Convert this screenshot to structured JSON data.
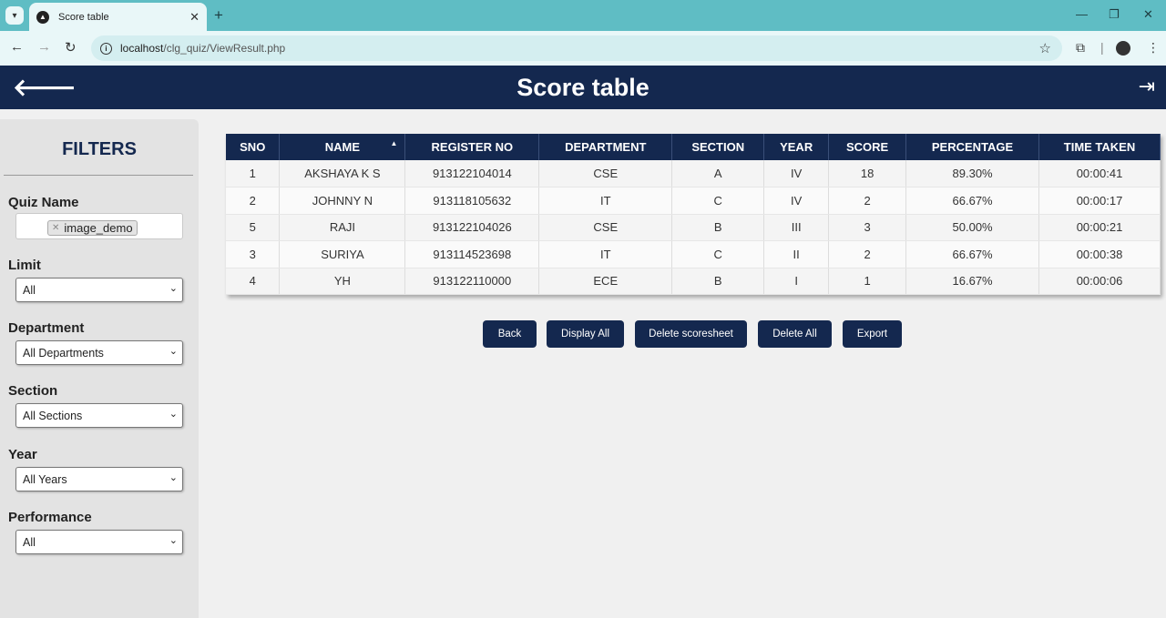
{
  "browser": {
    "tab_title": "Score table",
    "url_host": "localhost",
    "url_path": "/clg_quiz/ViewResult.php"
  },
  "header": {
    "title": "Score table"
  },
  "filters": {
    "heading": "FILTERS",
    "quiz_name_label": "Quiz Name",
    "quiz_chip": "image_demo",
    "limit_label": "Limit",
    "limit_value": "All",
    "department_label": "Department",
    "department_value": "All Departments",
    "section_label": "Section",
    "section_value": "All Sections",
    "year_label": "Year",
    "year_value": "All Years",
    "performance_label": "Performance",
    "performance_value": "All"
  },
  "table": {
    "headers": [
      "SNO",
      "NAME",
      "REGISTER NO",
      "DEPARTMENT",
      "SECTION",
      "YEAR",
      "SCORE",
      "PERCENTAGE",
      "TIME TAKEN"
    ],
    "rows": [
      [
        "1",
        "AKSHAYA K S",
        "913122104014",
        "CSE",
        "A",
        "IV",
        "18",
        "89.30%",
        "00:00:41"
      ],
      [
        "2",
        "JOHNNY N",
        "913118105632",
        "IT",
        "C",
        "IV",
        "2",
        "66.67%",
        "00:00:17"
      ],
      [
        "5",
        "RAJI",
        "913122104026",
        "CSE",
        "B",
        "III",
        "3",
        "50.00%",
        "00:00:21"
      ],
      [
        "3",
        "SURIYA",
        "913114523698",
        "IT",
        "C",
        "II",
        "2",
        "66.67%",
        "00:00:38"
      ],
      [
        "4",
        "YH",
        "913122110000",
        "ECE",
        "B",
        "I",
        "1",
        "16.67%",
        "00:00:06"
      ]
    ]
  },
  "actions": {
    "back": "Back",
    "display_all": "Display All",
    "delete_scoresheet": "Delete scoresheet",
    "delete_all": "Delete All",
    "export": "Export"
  }
}
